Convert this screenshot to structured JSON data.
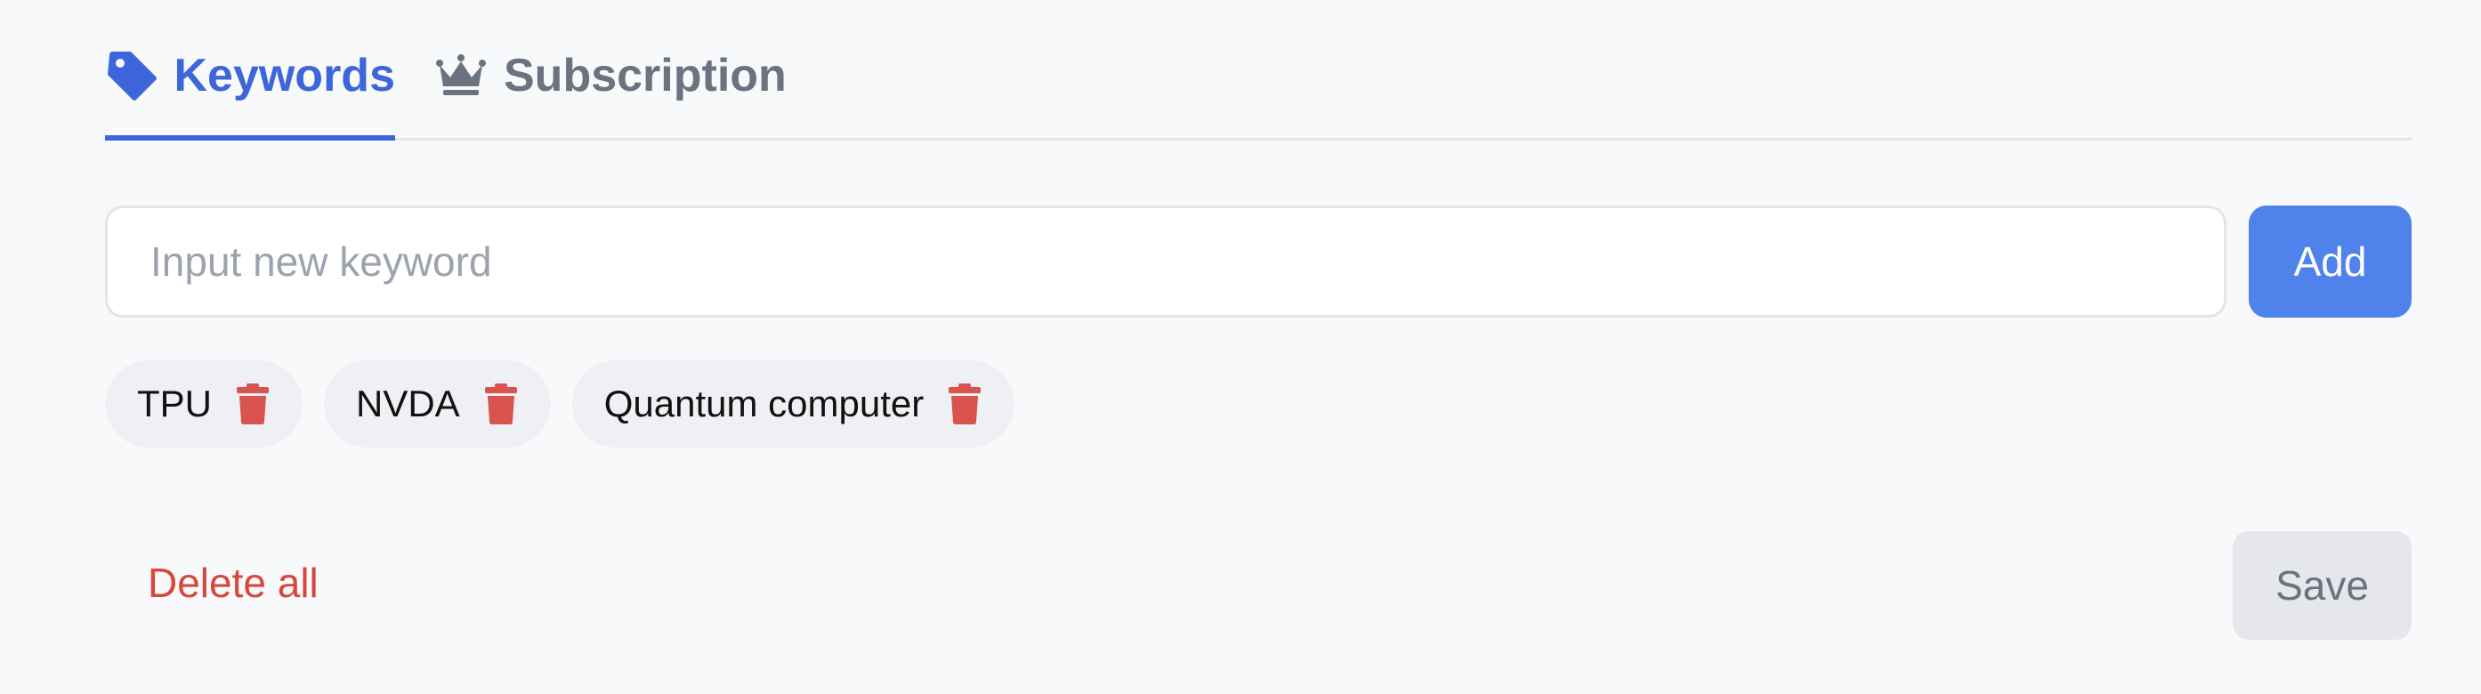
{
  "tabs": {
    "keywords": {
      "label": "Keywords",
      "icon": "tag-icon",
      "active": true
    },
    "subscription": {
      "label": "Subscription",
      "icon": "crown-icon",
      "active": false
    }
  },
  "keyword_input": {
    "value": "",
    "placeholder": "Input new keyword"
  },
  "add_button": {
    "label": "Add"
  },
  "keywords": [
    {
      "label": "TPU",
      "icon": "trash-icon"
    },
    {
      "label": "NVDA",
      "icon": "trash-icon"
    },
    {
      "label": "Quantum computer",
      "icon": "trash-icon"
    }
  ],
  "footer": {
    "delete_all_label": "Delete all",
    "save_label": "Save"
  },
  "colors": {
    "accent": "#3c66d9",
    "add_button": "#4f82ea",
    "danger": "#d9463b",
    "inactive_tab": "#6b7280",
    "background": "#f8f9fb"
  }
}
